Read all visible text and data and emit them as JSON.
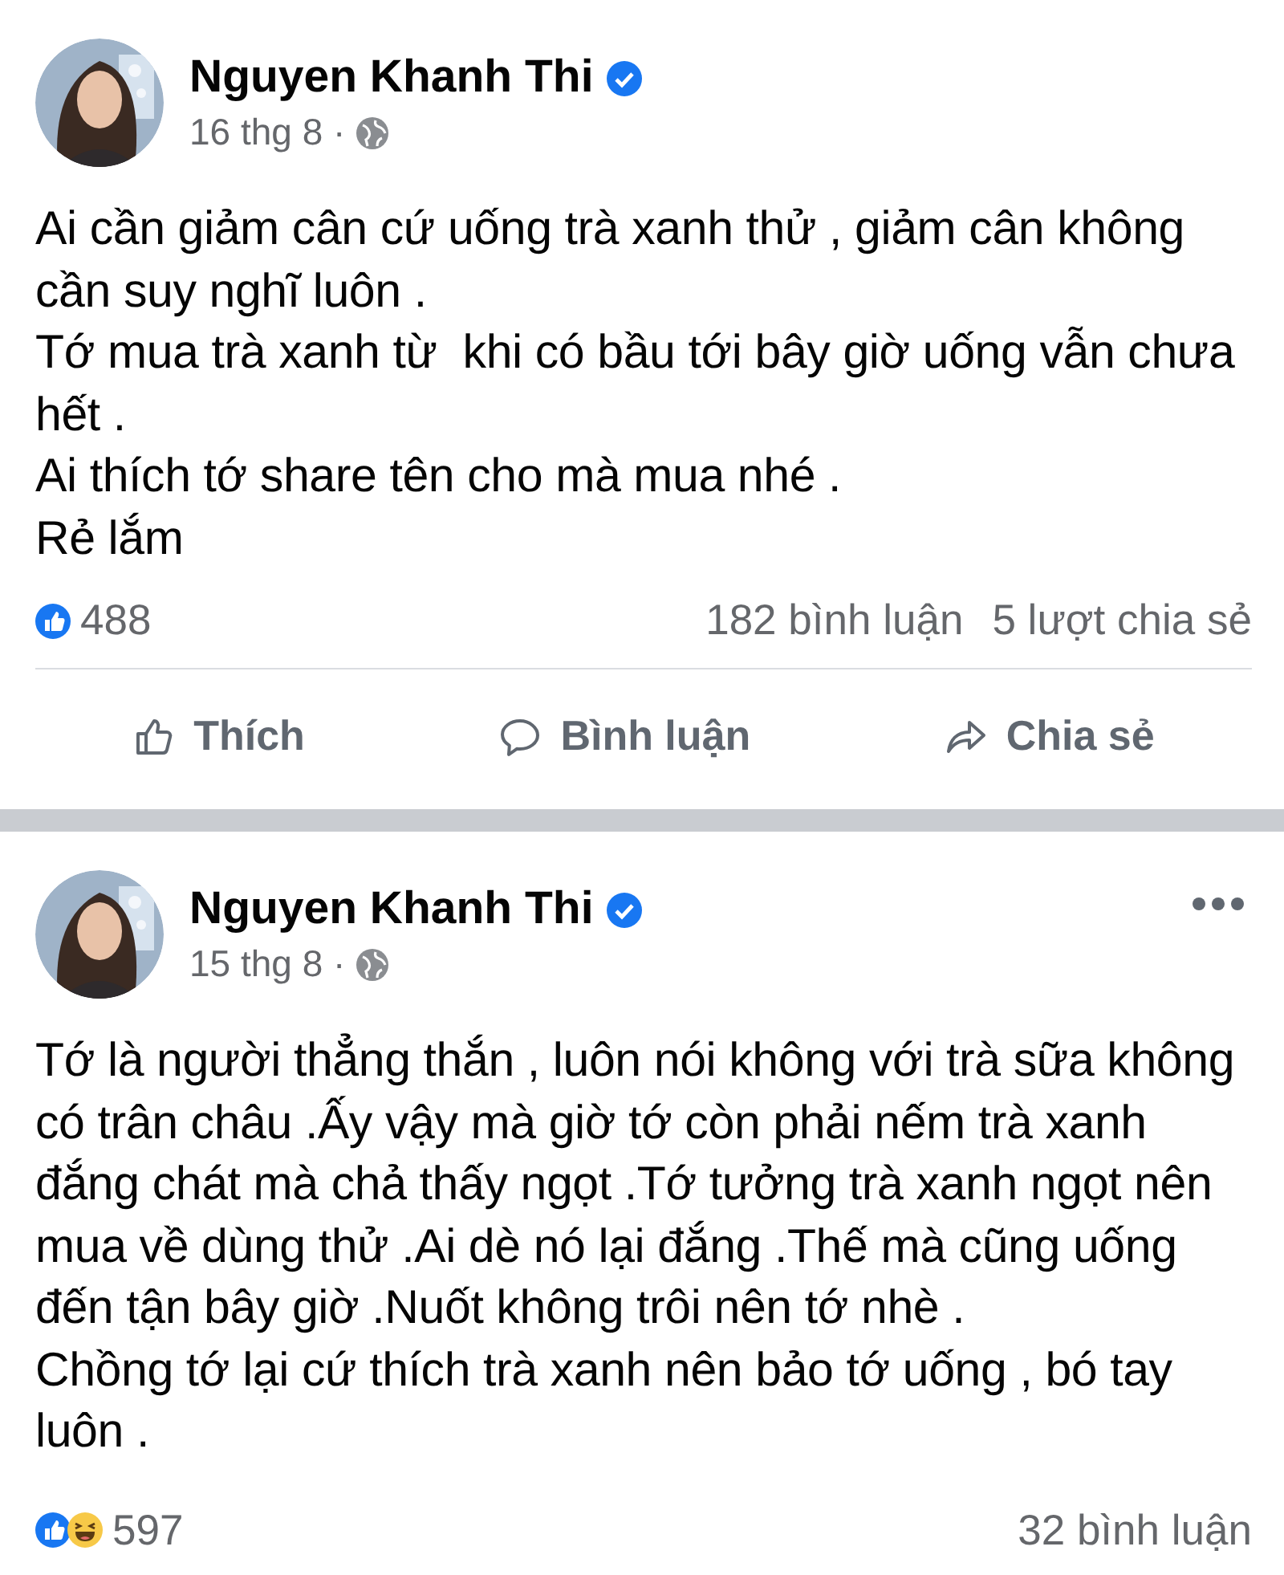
{
  "posts": [
    {
      "author": "Nguyen Khanh Thi",
      "verified": true,
      "time": "16 thg 8 ·",
      "menu": false,
      "body": [
        "Ai cần giảm cân cứ uống trà xanh thử , giảm cân không",
        "cần suy nghĩ luôn .",
        "Tớ mua trà xanh từ  khi có bầu tới bây giờ uống vẫn chưa",
        "hết .",
        "Ai thích tớ share tên cho mà mua nhé .",
        "Rẻ lắm"
      ],
      "reactions": [
        {
          "kind": "like"
        }
      ],
      "reaction_count": "488",
      "comments": "182 bình luận",
      "shares": "5 lượt chia sẻ",
      "actions": [
        {
          "kind": "like",
          "label": "Thích"
        },
        {
          "kind": "comment",
          "label": "Bình luận"
        },
        {
          "kind": "share",
          "label": "Chia sẻ"
        }
      ]
    },
    {
      "author": "Nguyen Khanh Thi",
      "verified": true,
      "time": "15 thg 8 ·",
      "menu": true,
      "body": [
        "Tớ là người thẳng thắn , luôn nói không với trà sữa không",
        "có trân châu .Ấy vậy mà giờ tớ còn phải nếm trà xanh",
        "đắng chát mà chả thấy ngọt .Tớ tưởng trà xanh ngọt nên",
        "mua về dùng thử .Ai dè nó lại đắng .Thế mà cũng uống",
        "đến tận bây giờ .Nuốt không trôi nên tớ nhè .",
        "Chồng tớ lại cứ thích trà xanh nên bảo tớ uống , bó tay",
        "luôn ."
      ],
      "reactions": [
        {
          "kind": "like"
        },
        {
          "kind": "haha"
        }
      ],
      "reaction_count": "597",
      "comments": "32 bình luận"
    }
  ]
}
